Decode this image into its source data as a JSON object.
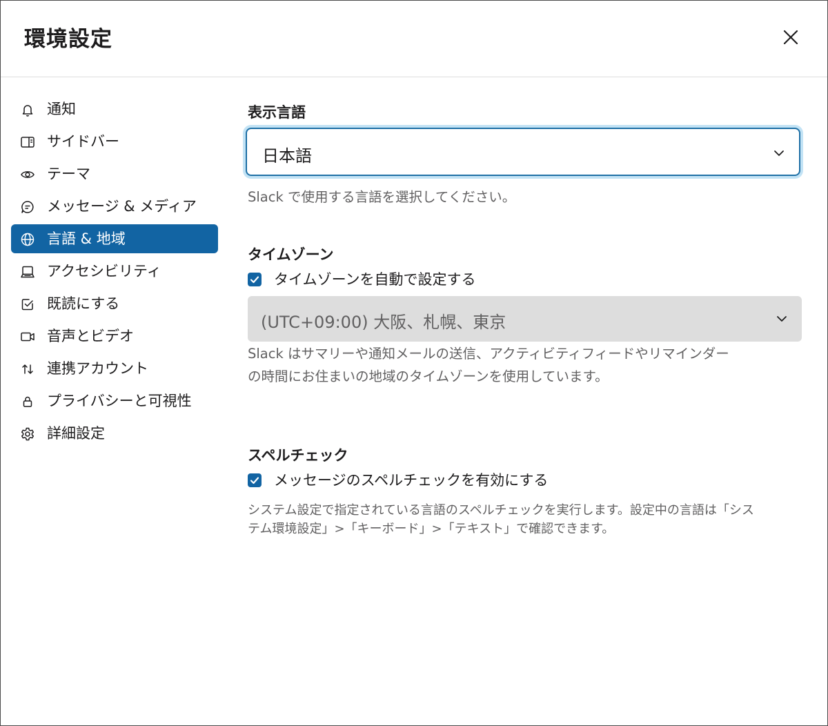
{
  "window": {
    "title": "環境設定"
  },
  "sidebar": {
    "items": [
      {
        "label": "通知",
        "icon": "bell-icon"
      },
      {
        "label": "サイドバー",
        "icon": "sidebar-icon"
      },
      {
        "label": "テーマ",
        "icon": "eye-icon"
      },
      {
        "label": "メッセージ & メディア",
        "icon": "message-icon"
      },
      {
        "label": "言語 & 地域",
        "icon": "globe-icon",
        "active": true
      },
      {
        "label": "アクセシビリティ",
        "icon": "laptop-icon"
      },
      {
        "label": "既読にする",
        "icon": "check-square-icon"
      },
      {
        "label": "音声とビデオ",
        "icon": "video-icon"
      },
      {
        "label": "連携アカウント",
        "icon": "arrows-icon"
      },
      {
        "label": "プライバシーと可視性",
        "icon": "lock-icon"
      },
      {
        "label": "詳細設定",
        "icon": "gear-icon"
      }
    ]
  },
  "language": {
    "heading": "表示言語",
    "selected": "日本語",
    "help": "Slack で使用する言語を選択してください。"
  },
  "timezone": {
    "heading": "タイムゾーン",
    "auto_label": "タイムゾーンを自動で設定する",
    "auto_checked": true,
    "selected": "(UTC+09:00) 大阪、札幌、東京",
    "help_line1": "Slack はサマリーや通知メールの送信、アクティビティフィードやリマインダー",
    "help_line2": "の時間にお住まいの地域のタイムゾーンを使用しています。"
  },
  "spellcheck": {
    "heading": "スペルチェック",
    "enable_label": "メッセージのスペルチェックを有効にする",
    "enable_checked": true,
    "help_line1": "システム設定で指定されている言語のスペルチェックを実行します。設定中の言語は「シス",
    "help_line2": "テム環境設定」>「キーボード」>「テキスト」で確認できます。"
  },
  "colors": {
    "accent": "#1264a3",
    "focus_ring": "#c3e3f5",
    "disabled_select_bg": "#dddddd",
    "muted_text": "#616061"
  }
}
